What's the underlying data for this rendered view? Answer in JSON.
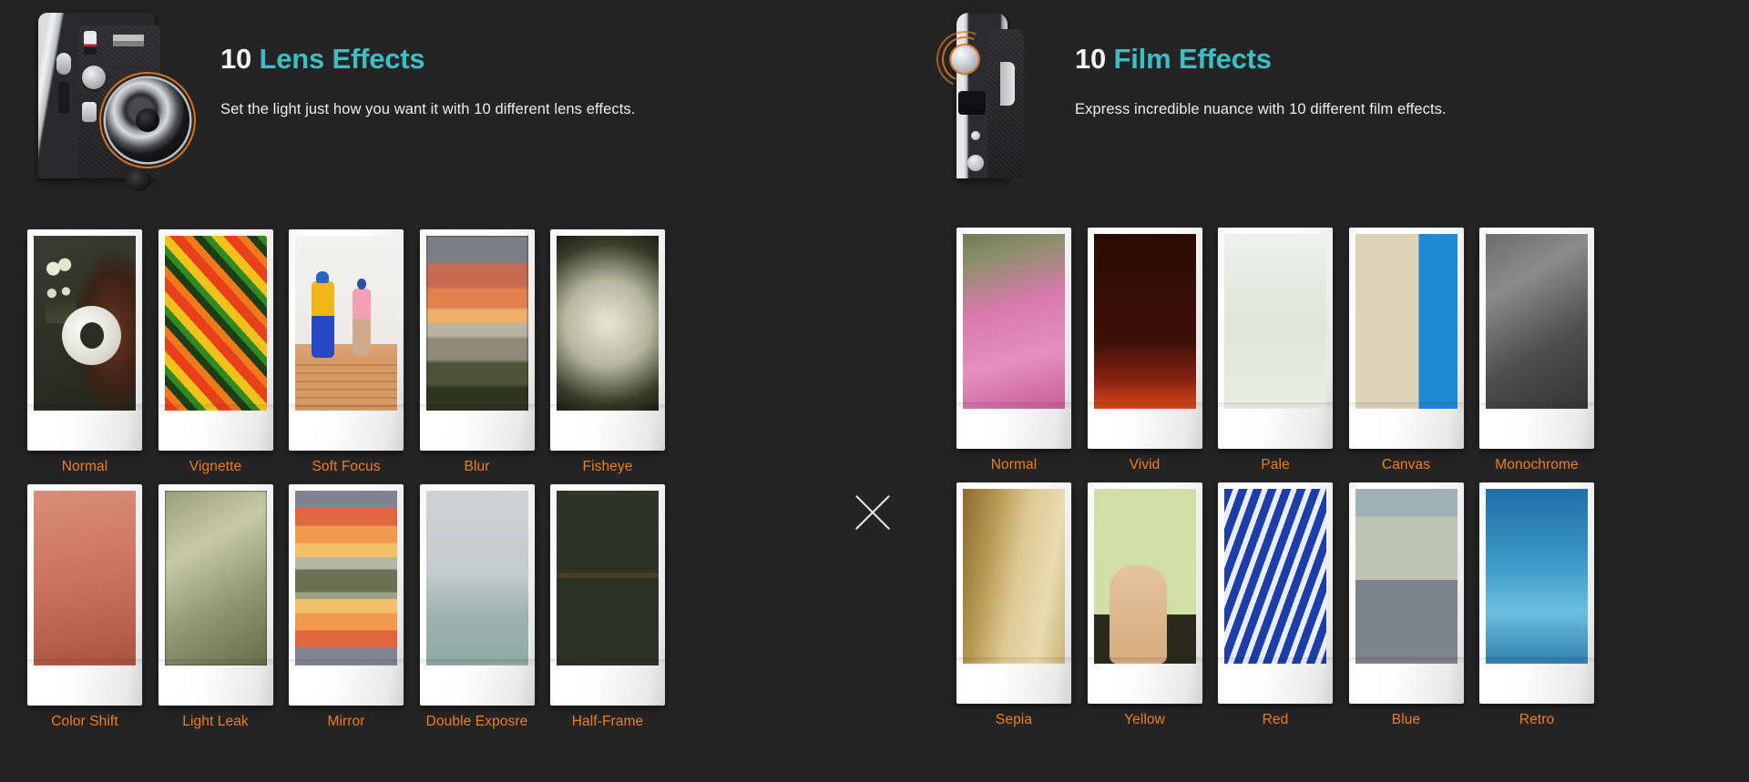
{
  "background_color": "#242424",
  "accent_teal": "#3dbec3",
  "accent_orange": "#f07d1e",
  "divider": {
    "symbol": "x",
    "name": "multiply-divider"
  },
  "panels": [
    {
      "id": "lens",
      "camera_icon": "instax-camera-front-icon",
      "title_number": "10",
      "title_label": "Lens Effects",
      "subtitle": "Set the light just how you want it with 10 different lens effects.",
      "effects": [
        {
          "label": "Normal",
          "art": "p-normal"
        },
        {
          "label": "Vignette",
          "art": "p-vignette"
        },
        {
          "label": "Soft Focus",
          "art": "p-soft"
        },
        {
          "label": "Blur",
          "art": "p-blur"
        },
        {
          "label": "Fisheye",
          "art": "p-fisheye"
        },
        {
          "label": "Color Shift",
          "art": "p-colorshift"
        },
        {
          "label": "Light Leak",
          "art": "p-lightleak"
        },
        {
          "label": "Mirror",
          "art": "p-mirror"
        },
        {
          "label": "Double Exposre",
          "art": "p-doubleexp"
        },
        {
          "label": "Half-Frame",
          "art": "p-halfframe"
        }
      ]
    },
    {
      "id": "film",
      "camera_icon": "instax-camera-side-icon",
      "title_number": "10",
      "title_label": "Film Effects",
      "subtitle": "Express incredible nuance with 10 different film effects.",
      "effects": [
        {
          "label": "Normal",
          "art": "p-fnormal"
        },
        {
          "label": "Vivid",
          "art": "p-vivid"
        },
        {
          "label": "Pale",
          "art": "p-pale"
        },
        {
          "label": "Canvas",
          "art": "p-canvas"
        },
        {
          "label": "Monochrome",
          "art": "p-mono"
        },
        {
          "label": "Sepia",
          "art": "p-sepia"
        },
        {
          "label": "Yellow",
          "art": "p-yellow"
        },
        {
          "label": "Red",
          "art": "p-red"
        },
        {
          "label": "Blue",
          "art": "p-blue"
        },
        {
          "label": "Retro",
          "art": "p-retro"
        }
      ]
    }
  ]
}
